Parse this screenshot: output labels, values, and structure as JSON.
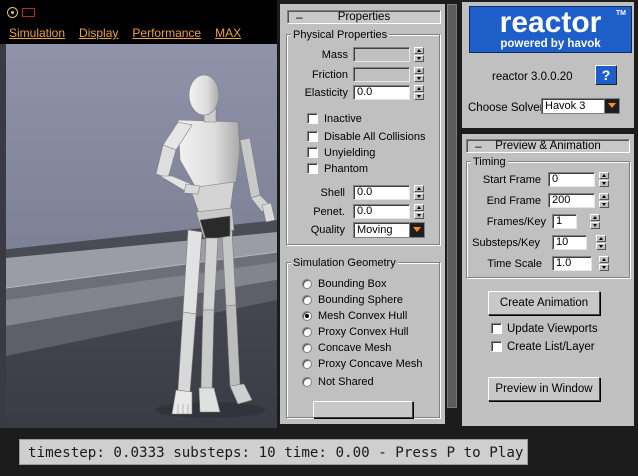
{
  "viewport": {
    "menu": [
      "Simulation",
      "Display",
      "Performance",
      "MAX"
    ]
  },
  "status": {
    "text": "timestep: 0.0333 substeps: 10 time: 0.00 - Press P to Play"
  },
  "properties": {
    "rollout_title": "Properties",
    "physical_group": "Physical Properties",
    "mass_label": "Mass",
    "mass_value": "",
    "friction_label": "Friction",
    "friction_value": "",
    "elasticity_label": "Elasticity",
    "elasticity_value": "0.0",
    "checkboxes": [
      "Inactive",
      "Disable All Collisions",
      "Unyielding",
      "Phantom"
    ],
    "shell_label": "Shell",
    "shell_value": "0.0",
    "penet_label": "Penet.",
    "penet_value": "0.0",
    "quality_label": "Quality",
    "quality_value": "Moving",
    "geometry_group": "Simulation Geometry",
    "geometry_options": [
      "Bounding Box",
      "Bounding Sphere",
      "Mesh Convex Hull",
      "Proxy Convex Hull",
      "Concave Mesh",
      "Proxy Concave Mesh",
      "Not Shared"
    ],
    "geometry_selected": "Mesh Convex Hull"
  },
  "reactor": {
    "logo_main": "reactor",
    "logo_sub": "powered by havok",
    "logo_tm": "TM",
    "version": "reactor 3.0.0.20",
    "help_label": "?",
    "solver_label": "Choose Solver:",
    "solver_value": "Havok 3"
  },
  "preview": {
    "rollout_title": "Preview & Animation",
    "timing_group": "Timing",
    "start_frame_label": "Start Frame",
    "start_frame_value": "0",
    "end_frame_label": "End Frame",
    "end_frame_value": "200",
    "frames_key_label": "Frames/Key",
    "frames_key_value": "1",
    "substeps_key_label": "Substeps/Key",
    "substeps_key_value": "10",
    "time_scale_label": "Time Scale",
    "time_scale_value": "1.0",
    "create_animation_label": "Create Animation",
    "update_viewports_label": "Update Viewports",
    "create_list_label": "Create List/Layer",
    "preview_window_label": "Preview in Window"
  }
}
